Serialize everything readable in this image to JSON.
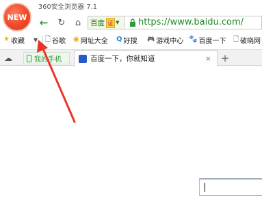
{
  "window": {
    "title": "360安全浏览器 7.1"
  },
  "logo": {
    "text": "NEW"
  },
  "nav": {
    "back_icon": "←",
    "refresh_icon": "↻",
    "home_icon": "⌂",
    "engine_label": "百度",
    "engine_badge": "证",
    "url": "https://www.baidu.com/"
  },
  "bookmarks": [
    {
      "label": "收藏",
      "icon": "★"
    },
    {
      "label": "谷歌",
      "icon": "🗋"
    },
    {
      "label": "网址大全",
      "icon": "◉"
    },
    {
      "label": "好搜",
      "icon": "Q"
    },
    {
      "label": "游戏中心",
      "icon": "🎮"
    },
    {
      "label": "百度一下",
      "icon": "🐾"
    },
    {
      "label": "破晓网",
      "icon": "🗋"
    }
  ],
  "tabs": {
    "pinned_label": "我的手机",
    "active_label": "百度一下，你就知道",
    "close_icon": "×",
    "new_tab_icon": "+"
  },
  "colors": {
    "accent_green": "#2e9a3c",
    "annotation_red": "#e8362a"
  }
}
